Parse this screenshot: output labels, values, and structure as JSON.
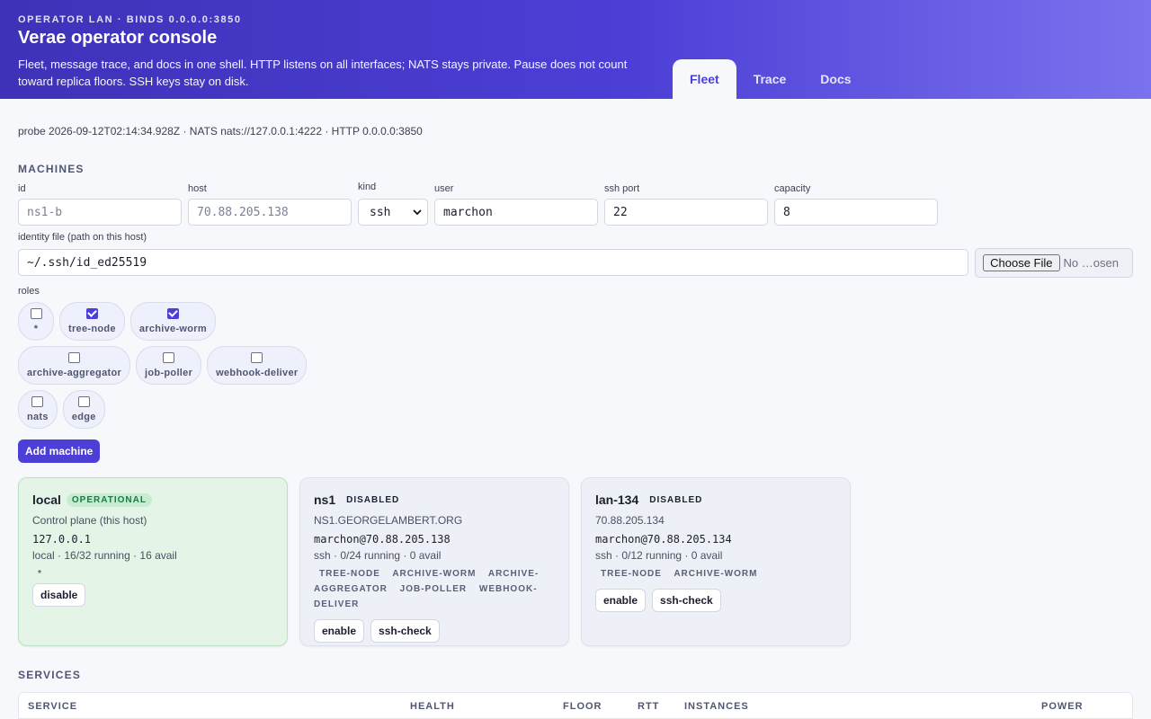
{
  "header": {
    "eyebrow": "OPERATOR LAN · BINDS 0.0.0.0:3850",
    "title": "Verae operator console",
    "description": "Fleet, message trace, and docs in one shell. HTTP listens on all interfaces; NATS stays private. Pause does not count toward replica floors. SSH keys stay on disk.",
    "tabs": [
      {
        "label": "Fleet",
        "active": true
      },
      {
        "label": "Trace",
        "active": false
      },
      {
        "label": "Docs",
        "active": false
      }
    ]
  },
  "probe": "probe 2026-09-12T02:14:34.928Z · NATS nats://127.0.0.1:4222 · HTTP 0.0.0.0:3850",
  "machines_form": {
    "section_title": "MACHINES",
    "id": {
      "label": "id",
      "placeholder": "ns1-b"
    },
    "host": {
      "label": "host",
      "placeholder": "70.88.205.138"
    },
    "kind": {
      "label": "kind",
      "value": "ssh"
    },
    "user": {
      "label": "user",
      "value": "marchon"
    },
    "ssh_port": {
      "label": "ssh port",
      "value": "22"
    },
    "capacity": {
      "label": "capacity",
      "value": "8"
    },
    "identity": {
      "label": "identity file (path on this host)",
      "value": "~/.ssh/id_ed25519"
    },
    "file_button": "Choose File",
    "file_status": "No …osen",
    "roles_label": "roles",
    "roles": [
      {
        "label": "*",
        "checked": false
      },
      {
        "label": "tree-node",
        "checked": true
      },
      {
        "label": "archive-worm",
        "checked": true
      },
      {
        "label": "archive-aggregator",
        "checked": false
      },
      {
        "label": "job-poller",
        "checked": false
      },
      {
        "label": "webhook-deliver",
        "checked": false
      },
      {
        "label": "nats",
        "checked": false
      },
      {
        "label": "edge",
        "checked": false
      }
    ],
    "add_button": "Add machine"
  },
  "machines": [
    {
      "name": "local",
      "status": "OPERATIONAL",
      "subtitle": "Control plane (this host)",
      "address": "127.0.0.1",
      "stats": "local · 16/32 running · 16 avail",
      "roles": [
        "*"
      ],
      "buttons": [
        "disable"
      ]
    },
    {
      "name": "ns1",
      "status": "DISABLED",
      "subtitle": "ns1.georgelambert.org",
      "address": "marchon@70.88.205.138",
      "stats": "ssh · 0/24 running · 0 avail",
      "roles": [
        "TREE-NODE",
        "ARCHIVE-WORM",
        "ARCHIVE-AGGREGATOR",
        "JOB-POLLER",
        "WEBHOOK-DELIVER"
      ],
      "buttons": [
        "enable",
        "ssh-check"
      ]
    },
    {
      "name": "lan-134",
      "status": "DISABLED",
      "subtitle": "70.88.205.134",
      "address": "marchon@70.88.205.134",
      "stats": "ssh · 0/12 running · 0 avail",
      "roles": [
        "TREE-NODE",
        "ARCHIVE-WORM"
      ],
      "buttons": [
        "enable",
        "ssh-check"
      ]
    }
  ],
  "services": {
    "section_title": "SERVICES",
    "columns": [
      "SERVICE",
      "HEALTH",
      "FLOOR",
      "RTT",
      "INSTANCES",
      "POWER"
    ]
  }
}
